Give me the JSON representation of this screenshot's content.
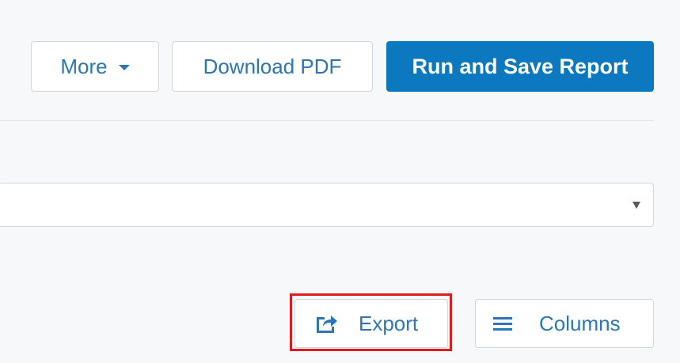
{
  "toolbar": {
    "more_label": "More",
    "download_pdf_label": "Download PDF",
    "run_and_save_label": "Run and Save Report"
  },
  "select": {
    "value": ""
  },
  "actions": {
    "export_label": "Export",
    "columns_label": "Columns"
  },
  "colors": {
    "accent": "#0b78bf",
    "link_text": "#2c76b7",
    "highlight": "#e01b1b",
    "border": "#cfd6dc"
  },
  "icons": {
    "more_caret": "caret-down-icon",
    "select_arrow": "dropdown-arrow-icon",
    "export": "share-export-icon",
    "columns": "menu-lines-icon"
  }
}
